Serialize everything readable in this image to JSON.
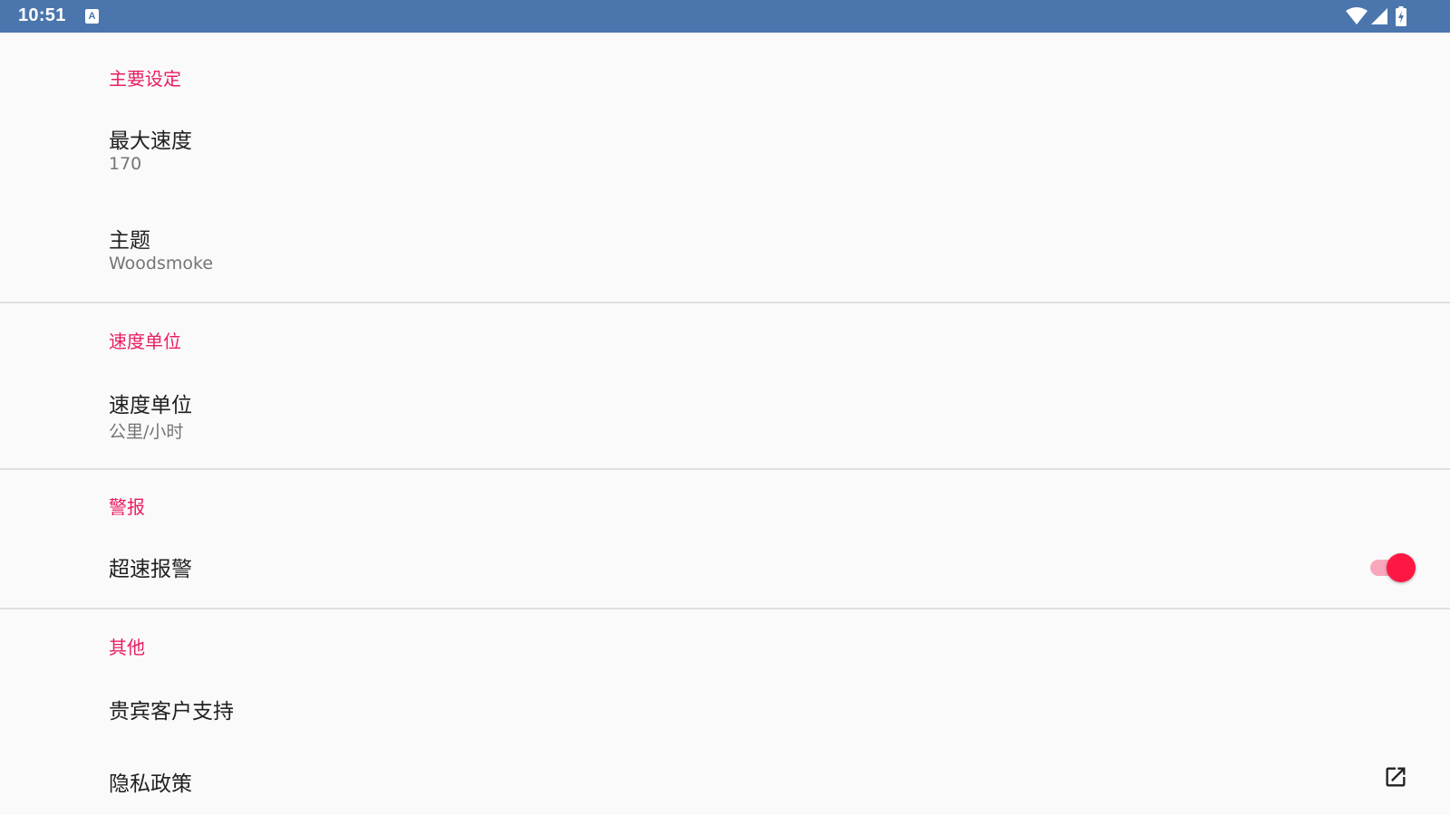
{
  "status_bar": {
    "time": "10:51",
    "notification_icon": "a-icon",
    "notification_icon_letter": "A",
    "icons": [
      "wifi-icon",
      "cell-signal-icon",
      "battery-charging-icon"
    ],
    "background": "#4a76ad"
  },
  "accent_color": "#e91e63",
  "sections": {
    "main": {
      "header": "主要设定",
      "max_speed": {
        "title": "最大速度",
        "summary": "170"
      },
      "theme": {
        "title": "主题",
        "summary": "Woodsmoke"
      }
    },
    "speed_unit": {
      "header": "速度单位",
      "unit": {
        "title": "速度单位",
        "summary": " 公里/小时"
      }
    },
    "alerts": {
      "header": "警报",
      "overspeed": {
        "title": "超速报警",
        "enabled": true
      }
    },
    "other": {
      "header": "其他",
      "vip_support": {
        "title": "贵宾客户支持"
      },
      "privacy_policy": {
        "title": "隐私政策",
        "icon": "open-in-new-icon"
      }
    }
  }
}
